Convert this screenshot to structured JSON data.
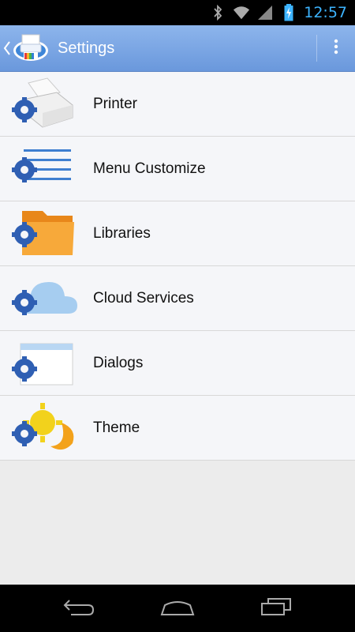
{
  "status_bar": {
    "time": "12:57",
    "icons": [
      "bluetooth-icon",
      "wifi-icon",
      "signal-icon",
      "battery-charging-icon"
    ]
  },
  "action_bar": {
    "title": "Settings",
    "back_icon": "chevron-left-icon",
    "app_icon": "printer-app-icon",
    "overflow_icon": "more-vert-icon"
  },
  "settings": {
    "items": [
      {
        "label": "Printer",
        "icon": "printer-gear-icon"
      },
      {
        "label": "Menu Customize",
        "icon": "menu-gear-icon"
      },
      {
        "label": "Libraries",
        "icon": "folder-gear-icon"
      },
      {
        "label": "Cloud Services",
        "icon": "cloud-gear-icon"
      },
      {
        "label": "Dialogs",
        "icon": "dialog-gear-icon"
      },
      {
        "label": "Theme",
        "icon": "sun-moon-gear-icon"
      }
    ]
  },
  "nav_bar": {
    "buttons": [
      "back-nav-icon",
      "home-nav-icon",
      "recent-apps-icon"
    ]
  },
  "colors": {
    "accent": "#3db4ff",
    "action_bar": "#7aa6e4",
    "gear": "#2f5fb3",
    "folder": "#f6a52b",
    "cloud": "#9ec7ee"
  }
}
